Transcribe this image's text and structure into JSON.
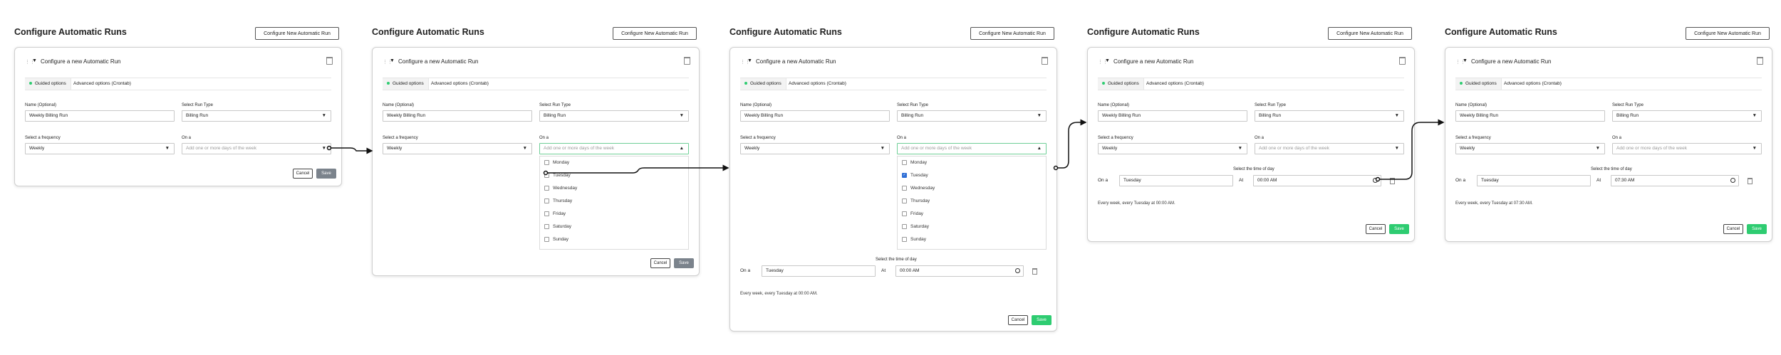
{
  "page_title": "Configure Automatic Runs",
  "new_run_button": "Configure New Automatic Run",
  "card": {
    "title": "Configure a new Automatic Run",
    "tabs": {
      "guided": "Guided options",
      "advanced": "Advanced options (Crontab)"
    },
    "name_label": "Name (Optional)",
    "name_value": "Weekly Billing Run",
    "run_type_label": "Select Run Type",
    "run_type_value": "Billing Run",
    "frequency_label": "Select a frequency",
    "frequency_value": "Weekly",
    "on_a_label": "On a",
    "days_placeholder": "Add one or more days of the week",
    "days": [
      "Monday",
      "Tuesday",
      "Wednesday",
      "Thursday",
      "Friday",
      "Saturday",
      "Sunday"
    ],
    "time_title": "Select the time of day",
    "row_on_a": "On a",
    "row_day": "Tuesday",
    "row_at": "At",
    "time_default": "00:00 AM",
    "time_final": "07:30 AM",
    "summary_default": "Every week, every Tuesday at 00:00 AM.",
    "summary_final": "Every week, every Tuesday at 07:30 AM.",
    "cancel": "Cancel",
    "save": "Save"
  },
  "icons": [
    "drag-handle-icon",
    "collapse-triangle-icon",
    "trash-icon",
    "chevron-down-icon",
    "chevron-up-icon",
    "clock-icon",
    "checkbox-icon",
    "flow-arrow-icon"
  ],
  "colors": {
    "accent_green": "#2ecc71",
    "save_disabled": "#7b838c",
    "checkbox_checked": "#2f6fd6",
    "open_border": "#6fcf97"
  }
}
